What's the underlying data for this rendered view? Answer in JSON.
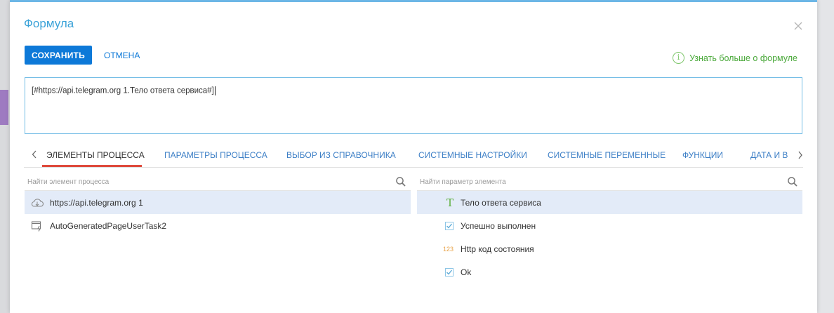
{
  "dialog": {
    "title": "Формула",
    "save_label": "СОХРАНИТЬ",
    "cancel_label": "ОТМЕНА",
    "learn_more_label": "Узнать больше о формуле",
    "formula_value": "[#https://api.telegram.org 1.Тело ответа сервиса#]"
  },
  "tabs": [
    {
      "label": "ЭЛЕМЕНТЫ ПРОЦЕССА",
      "active": true
    },
    {
      "label": "ПАРАМЕТРЫ ПРОЦЕССА",
      "active": false
    },
    {
      "label": "ВЫБОР ИЗ СПРАВОЧНИКА",
      "active": false
    },
    {
      "label": "СИСТЕМНЫЕ НАСТРОЙКИ",
      "active": false
    },
    {
      "label": "СИСТЕМНЫЕ ПЕРЕМЕННЫЕ",
      "active": false
    },
    {
      "label": "ФУНКЦИИ",
      "active": false
    },
    {
      "label": "ДАТА И В",
      "active": false
    }
  ],
  "left_pane": {
    "search_placeholder": "Найти элемент процесса",
    "items": [
      {
        "label": "https://api.telegram.org 1",
        "icon": "cloud-icon",
        "selected": true
      },
      {
        "label": "AutoGeneratedPageUserTask2",
        "icon": "page-user-task-icon",
        "selected": false
      }
    ]
  },
  "right_pane": {
    "search_placeholder": "Найти параметр элемента",
    "items": [
      {
        "label": "Тело ответа сервиса",
        "icon": "text-type-icon",
        "icon_glyph": "T",
        "selected": true
      },
      {
        "label": "Успешно выполнен",
        "icon": "boolean-type-icon",
        "selected": false
      },
      {
        "label": "Http код состояния",
        "icon": "number-type-icon",
        "icon_glyph": "123",
        "selected": false
      },
      {
        "label": "Ok",
        "icon": "boolean-type-icon",
        "selected": false
      }
    ]
  },
  "colors": {
    "accent_blue": "#0d79d8",
    "title_blue": "#3aa2d8",
    "tab_underline_red": "#de4a3c",
    "info_green": "#4ba93b",
    "selected_row": "#e3ebf8"
  }
}
